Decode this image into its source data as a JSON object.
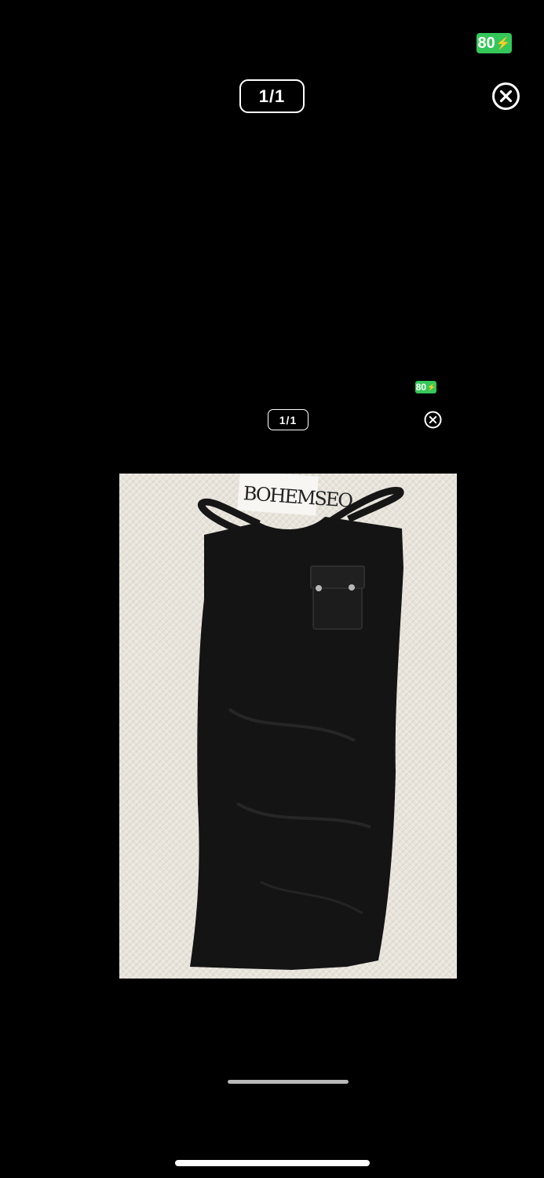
{
  "status": {
    "battery_level": "80",
    "battery_color": "#34c759"
  },
  "viewer": {
    "counter": "1/1",
    "close_icon": "close-circle-icon"
  },
  "inner_screenshot": {
    "battery_level": "80",
    "counter": "1/1",
    "close_icon": "close-circle-icon"
  },
  "photo": {
    "subject": "black midi skirt with cargo pocket on knit blanket",
    "tag_text": "BOHEMSEO"
  }
}
